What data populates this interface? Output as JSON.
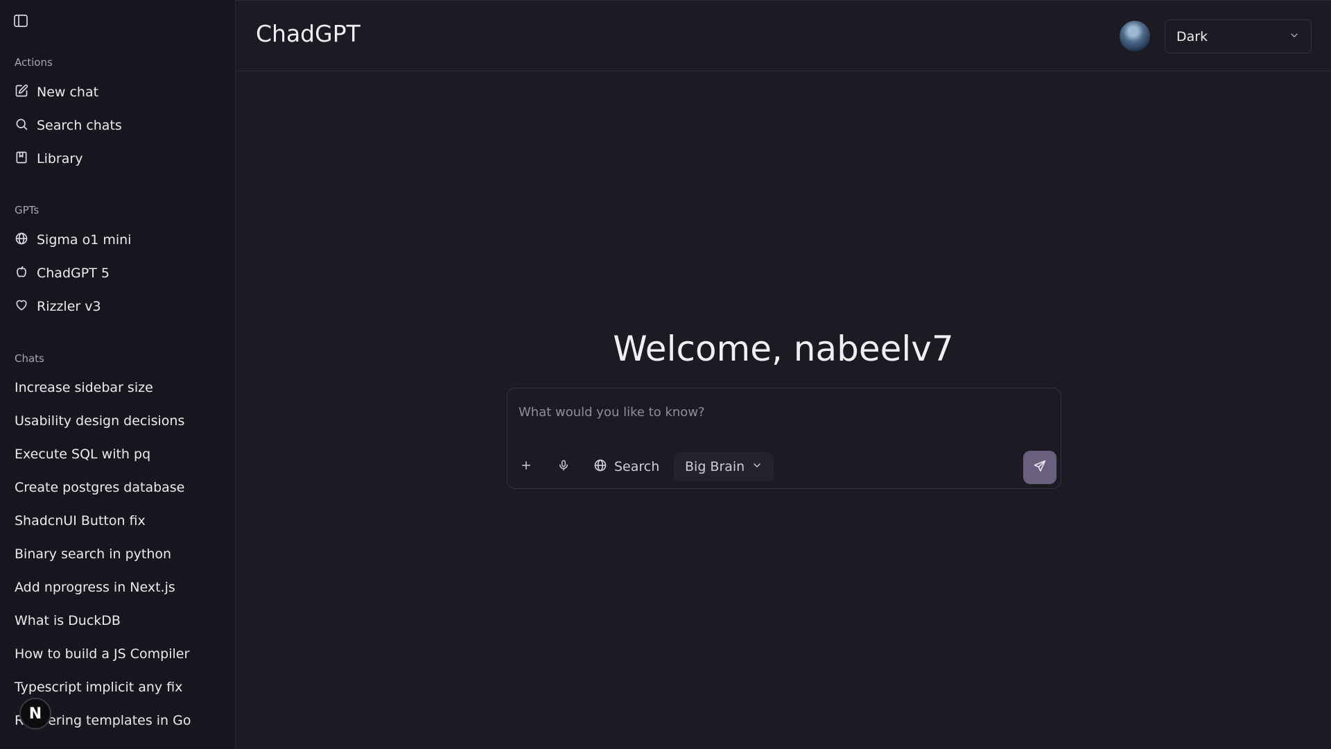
{
  "app": {
    "title": "ChadGPT"
  },
  "sidebar": {
    "sections": {
      "actions": "Actions",
      "gpts": "GPTs",
      "chats": "Chats"
    },
    "actions": [
      {
        "label": "New chat",
        "icon": "edit-icon"
      },
      {
        "label": "Search chats",
        "icon": "search-icon"
      },
      {
        "label": "Library",
        "icon": "book-icon"
      }
    ],
    "gpts": [
      {
        "label": "Sigma o1 mini",
        "icon": "globe-icon"
      },
      {
        "label": "ChadGPT 5",
        "icon": "apple-icon"
      },
      {
        "label": "Rizzler v3",
        "icon": "heart-icon"
      }
    ],
    "chats": [
      "Increase sidebar size",
      "Usability design decisions",
      "Execute SQL with pq",
      "Create postgres database",
      "ShadcnUI Button fix",
      "Binary search in python",
      "Add nprogress in Next.js",
      "What is DuckDB",
      "How to build a JS Compiler",
      "Typescript implicit any fix",
      "Rendering templates in Go"
    ],
    "badge": "N"
  },
  "header": {
    "theme_select": "Dark"
  },
  "main": {
    "welcome": "Welcome, nabeelv7",
    "composer": {
      "placeholder": "What would you like to know?",
      "search_label": "Search",
      "model_label": "Big Brain"
    }
  },
  "colors": {
    "background": "#1c1b24",
    "sidebar": "#17161e",
    "send_button": "#6a5f7e"
  }
}
